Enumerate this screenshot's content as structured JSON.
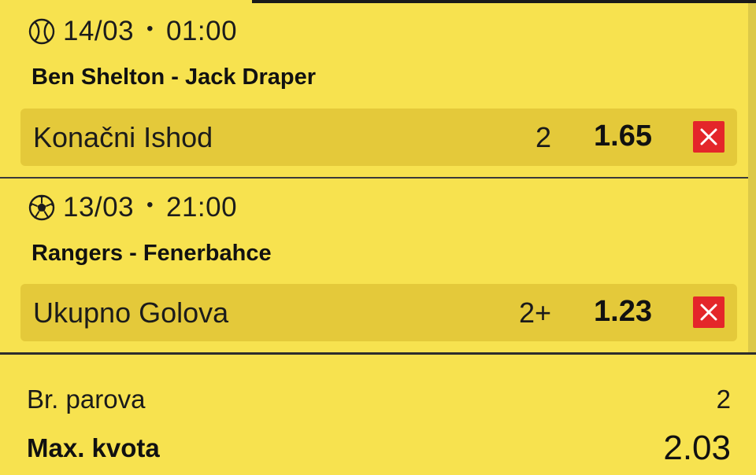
{
  "matches": [
    {
      "sport_icon": "tennis-ball-icon",
      "date": "14/03",
      "separator": "•",
      "time": "01:00",
      "teams": "Ben Shelton - Jack Draper",
      "bet": {
        "market": "Konačni Ishod",
        "pick": "2",
        "odds": "1.65"
      }
    },
    {
      "sport_icon": "soccer-ball-icon",
      "date": "13/03",
      "separator": "•",
      "time": "21:00",
      "teams": "Rangers - Fenerbahce",
      "bet": {
        "market": "Ukupno Golova",
        "pick": "2+",
        "odds": "1.23"
      }
    }
  ],
  "summary": {
    "pairs_label": "Br. parova",
    "pairs_value": "2",
    "max_odds_label": "Max. kvota",
    "max_odds_value": "2.03"
  },
  "colors": {
    "background": "#f7e24f",
    "bet_row": "#e4c93a",
    "remove_button": "#e4262a",
    "text": "#111111"
  }
}
